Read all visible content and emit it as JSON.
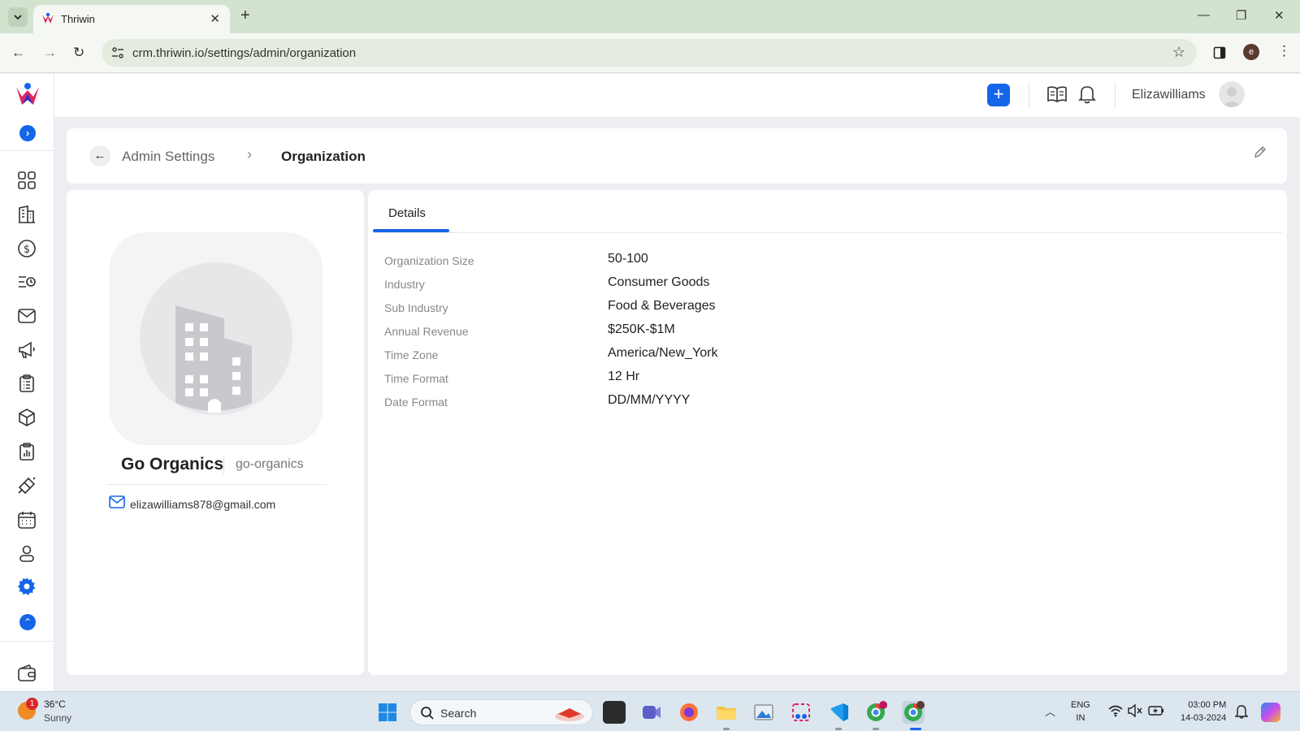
{
  "browser": {
    "tab_title": "Thriwin",
    "url": "crm.thriwin.io/settings/admin/organization",
    "profile_initial": "e"
  },
  "header": {
    "user_name": "Elizawilliams"
  },
  "sidebar": {
    "items": [
      {
        "name": "dashboard-icon"
      },
      {
        "name": "company-icon"
      },
      {
        "name": "deals-icon"
      },
      {
        "name": "activities-icon"
      },
      {
        "name": "email-icon"
      },
      {
        "name": "campaign-icon"
      },
      {
        "name": "tasks-icon"
      },
      {
        "name": "products-icon"
      },
      {
        "name": "reports-icon"
      },
      {
        "name": "integrations-icon"
      },
      {
        "name": "calendar-icon"
      },
      {
        "name": "contacts-icon"
      },
      {
        "name": "settings-icon"
      }
    ],
    "accent": "#1565e8"
  },
  "breadcrumb": {
    "parent": "Admin Settings",
    "current": "Organization"
  },
  "organization": {
    "name": "Go Organics",
    "slug": "go-organics",
    "email": "elizawilliams878@gmail.com"
  },
  "details": {
    "tab_label": "Details",
    "rows": [
      {
        "label": "Organization Size",
        "value": "50-100"
      },
      {
        "label": "Industry",
        "value": "Consumer Goods"
      },
      {
        "label": "Sub Industry",
        "value": "Food & Beverages"
      },
      {
        "label": "Annual Revenue",
        "value": "$250K-$1M"
      },
      {
        "label": "Time Zone",
        "value": "America/New_York"
      },
      {
        "label": "Time Format",
        "value": "12 Hr"
      },
      {
        "label": "Date Format",
        "value": "DD/MM/YYYY"
      }
    ]
  },
  "taskbar": {
    "weather_badge": "1",
    "temperature": "36°C",
    "condition": "Sunny",
    "search_placeholder": "Search",
    "lang_line1": "ENG",
    "lang_line2": "IN",
    "time": "03:00 PM",
    "date": "14-03-2024"
  }
}
